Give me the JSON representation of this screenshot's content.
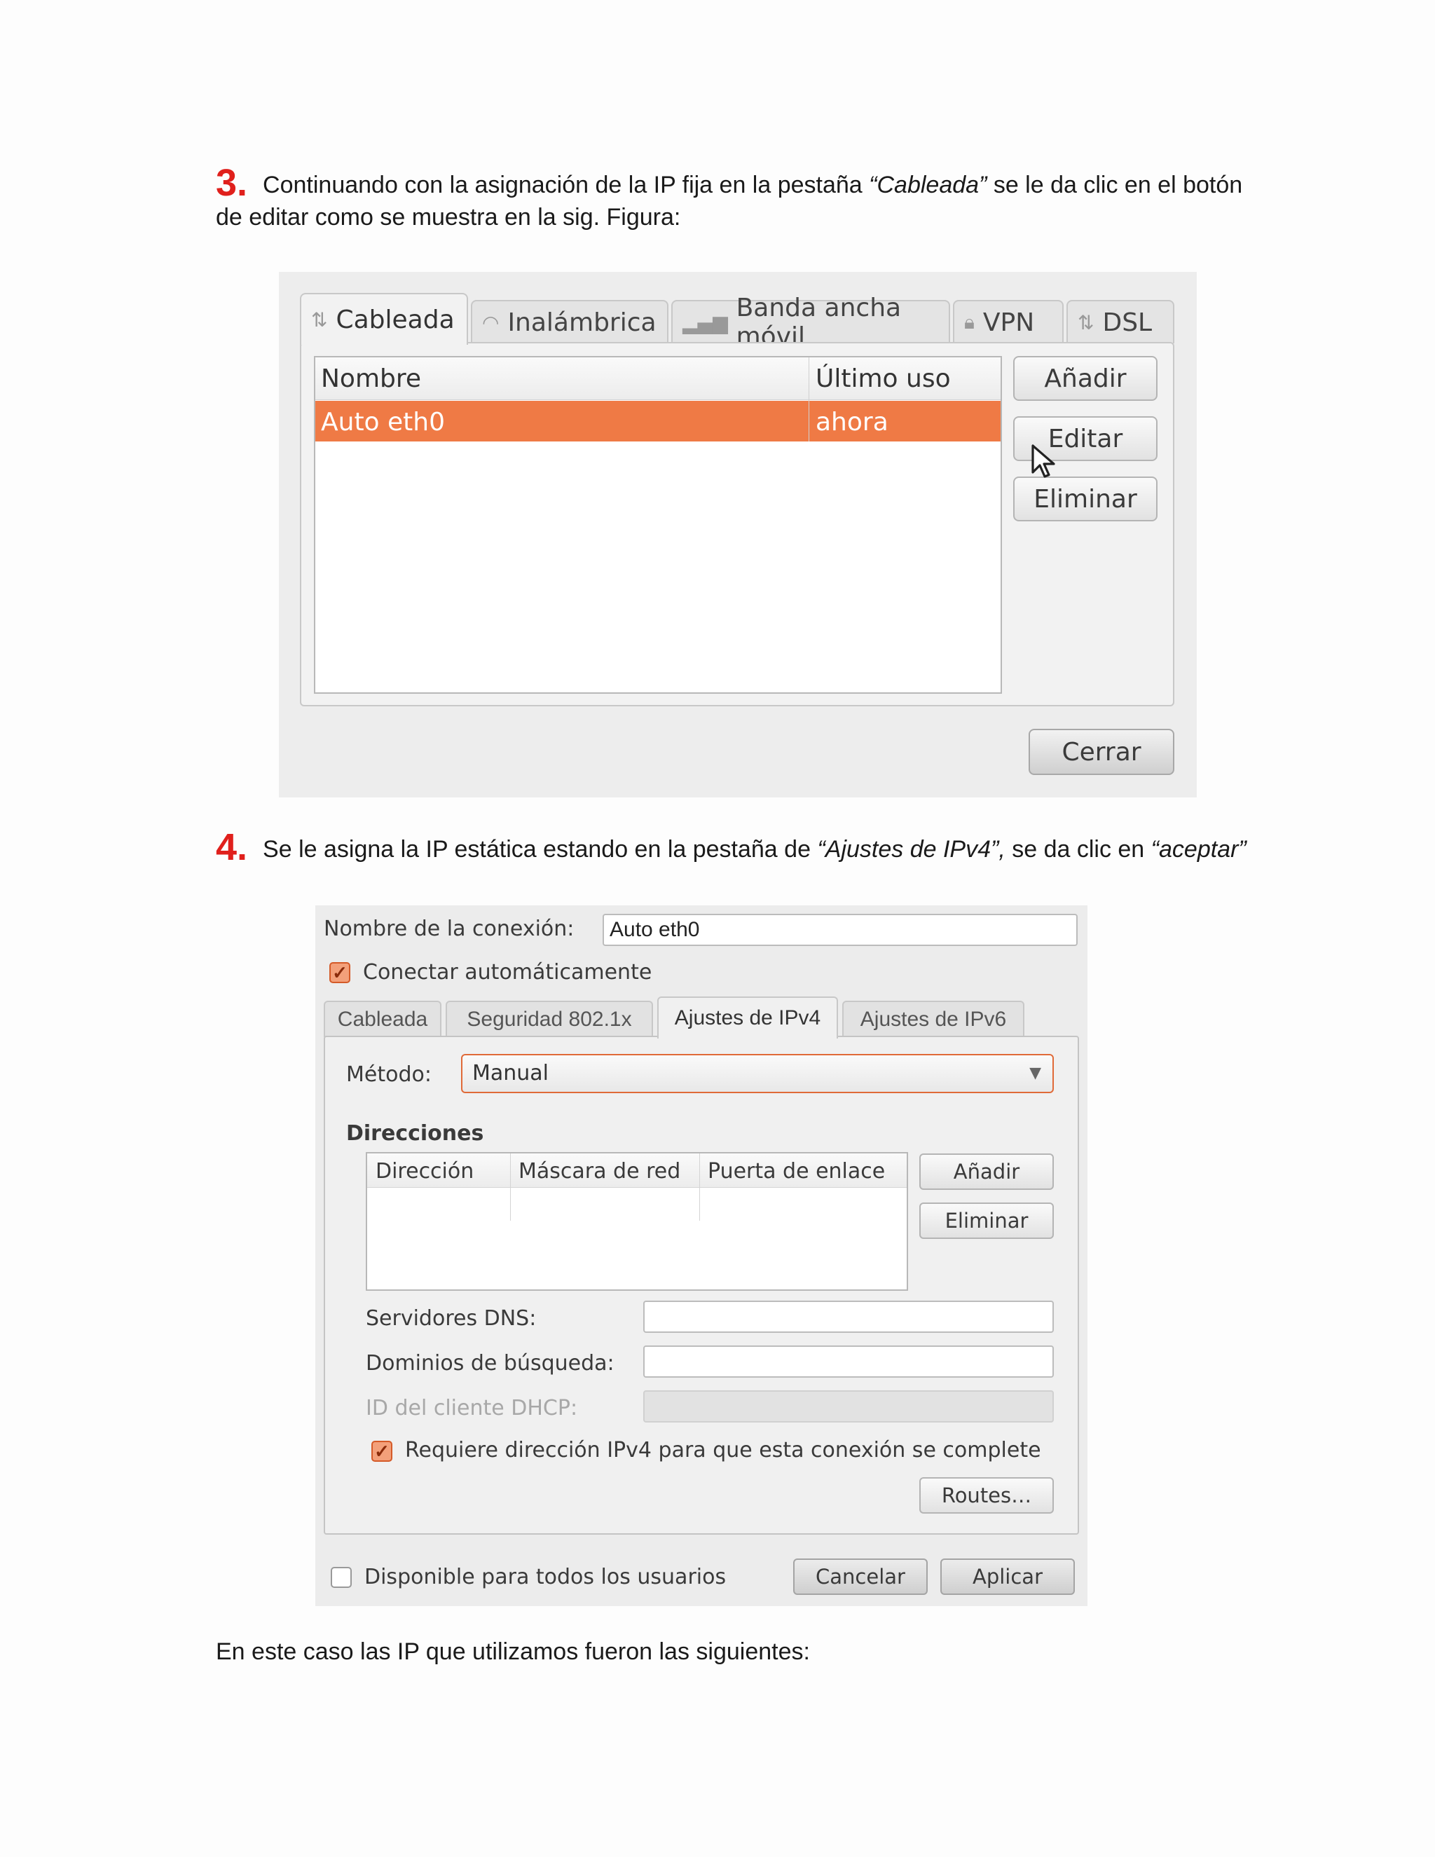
{
  "step3": {
    "number": "3.",
    "text_before": "Continuando con la asignación de la IP fija en la pestaña ",
    "tab_name": "“Cableada”",
    "text_after": " se le da clic en el botón de editar como se muestra en la sig. Figura:"
  },
  "figure1": {
    "tabs": [
      "Cableada",
      "Inalámbrica",
      "Banda ancha móvil",
      "VPN",
      "DSL"
    ],
    "columns": [
      "Nombre",
      "Último uso"
    ],
    "row": {
      "name": "Auto eth0",
      "last_used": "ahora"
    },
    "buttons": {
      "add": "Añadir",
      "edit": "Editar",
      "delete": "Eliminar",
      "close": "Cerrar"
    },
    "accent": "#ef7a45"
  },
  "step4": {
    "number": "4.",
    "text_before": "Se le asigna la IP estática  estando en la pestaña de ",
    "tab_name": "“Ajustes de IPv4”,",
    "text_middle": " se da clic en ",
    "action": "“aceptar”"
  },
  "figure2": {
    "connection_name_label": "Nombre de la conexión:",
    "connection_name_value": "Auto eth0",
    "auto_connect_label": "Conectar automáticamente",
    "tabs": [
      "Cableada",
      "Seguridad 802.1x",
      "Ajustes de IPv4",
      "Ajustes de IPv6"
    ],
    "method_label": "Método:",
    "method_value": "Manual",
    "addresses_heading": "Direcciones",
    "address_columns": [
      "Dirección",
      "Máscara de red",
      "Puerta de enlace"
    ],
    "buttons": {
      "add": "Añadir",
      "delete": "Eliminar",
      "routes": "Routes…",
      "cancel": "Cancelar",
      "apply": "Aplicar"
    },
    "dns_label": "Servidores DNS:",
    "search_domains_label": "Dominios de búsqueda:",
    "dhcp_id_label": "ID del cliente DHCP:",
    "require_ipv4_label": "Requiere dirección IPv4 para que esta conexión se complete",
    "all_users_label": "Disponible para todos los usuarios"
  },
  "closing_text": "En este caso las IP que utilizamos fueron las siguientes:"
}
